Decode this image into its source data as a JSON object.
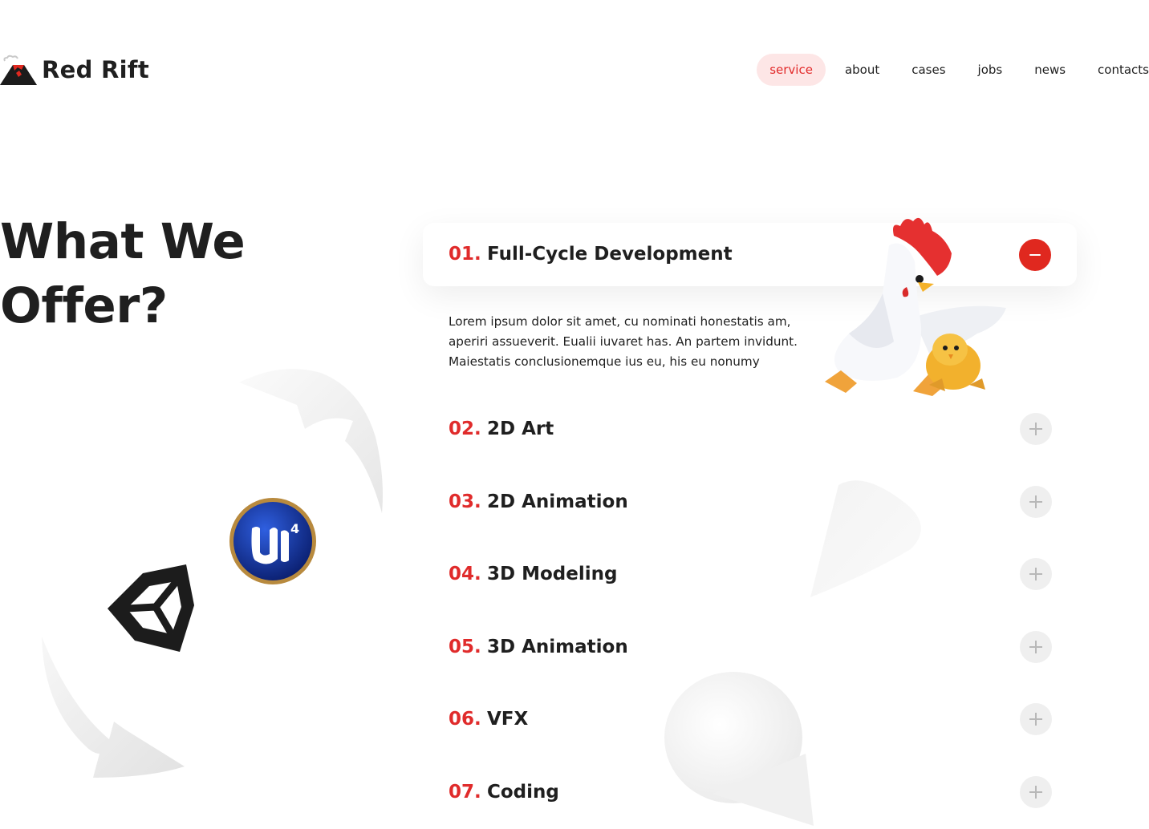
{
  "brand": {
    "name": "Red Rift",
    "accent": "#e0281f"
  },
  "nav": {
    "items": [
      {
        "label": "service",
        "active": true
      },
      {
        "label": "about",
        "active": false
      },
      {
        "label": "cases",
        "active": false
      },
      {
        "label": "jobs",
        "active": false
      },
      {
        "label": "news",
        "active": false
      },
      {
        "label": "contacts",
        "active": false
      }
    ]
  },
  "section": {
    "heading": "What We Offer?"
  },
  "services": {
    "open": {
      "number": "01.",
      "title": "Full-Cycle Development",
      "description": "Lorem ipsum dolor sit amet, cu nominati honestatis am, aperiri assueverit. Eualii iuvaret has. An partem invidunt. Maiestatis conclusionemque ius eu, his eu nonumy"
    },
    "items": [
      {
        "number": "02.",
        "title": "2D Art"
      },
      {
        "number": "03.",
        "title": "2D Animation"
      },
      {
        "number": "04.",
        "title": "3D Modeling"
      },
      {
        "number": "05.",
        "title": "3D Animation"
      },
      {
        "number": "06.",
        "title": "VFX"
      },
      {
        "number": "07.",
        "title": "Coding"
      }
    ]
  }
}
